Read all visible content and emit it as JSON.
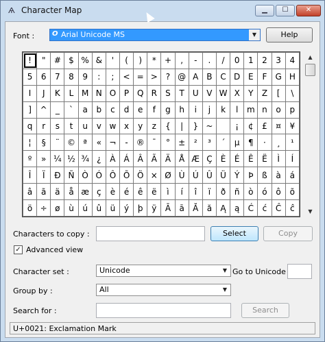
{
  "window": {
    "title": "Character Map",
    "app_icon": "character-map-icon",
    "controls": {
      "minimize": "▁",
      "maximize": "☐",
      "close": "✕"
    }
  },
  "font_row": {
    "label": "Font :",
    "selected": "Arial Unicode MS",
    "font_icon": "O",
    "help_label": "Help"
  },
  "grid": {
    "rows": [
      [
        "!",
        "\"",
        "#",
        "$",
        "%",
        "&",
        "'",
        "(",
        ")",
        "*",
        "+",
        ",",
        "-",
        ".",
        "/",
        "0",
        "1",
        "2",
        "3",
        "4"
      ],
      [
        "5",
        "6",
        "7",
        "8",
        "9",
        ":",
        ";",
        "<",
        "=",
        ">",
        "?",
        "@",
        "A",
        "B",
        "C",
        "D",
        "E",
        "F",
        "G",
        "H"
      ],
      [
        "I",
        "J",
        "K",
        "L",
        "M",
        "N",
        "O",
        "P",
        "Q",
        "R",
        "S",
        "T",
        "U",
        "V",
        "W",
        "X",
        "Y",
        "Z",
        "[",
        "\\"
      ],
      [
        "]",
        "^",
        "_",
        "`",
        "a",
        "b",
        "c",
        "d",
        "e",
        "f",
        "g",
        "h",
        "i",
        "j",
        "k",
        "l",
        "m",
        "n",
        "o",
        "p"
      ],
      [
        "q",
        "r",
        "s",
        "t",
        "u",
        "v",
        "w",
        "x",
        "y",
        "z",
        "{",
        "|",
        "}",
        "~",
        " ",
        "¡",
        "¢",
        "£",
        "¤",
        "¥"
      ],
      [
        "¦",
        "§",
        "¨",
        "©",
        "ª",
        "«",
        "¬",
        "-",
        "®",
        "¯",
        "°",
        "±",
        "²",
        "³",
        "´",
        "µ",
        "¶",
        "·",
        "¸",
        "¹"
      ],
      [
        "º",
        "»",
        "¼",
        "½",
        "¾",
        "¿",
        "À",
        "Á",
        "Â",
        "Ã",
        "Ä",
        "Å",
        "Æ",
        "Ç",
        "È",
        "É",
        "Ê",
        "Ë",
        "Ì",
        "Í"
      ],
      [
        "Î",
        "Ï",
        "Ð",
        "Ñ",
        "Ò",
        "Ó",
        "Ô",
        "Õ",
        "Ö",
        "×",
        "Ø",
        "Ù",
        "Ú",
        "Û",
        "Ü",
        "Ý",
        "Þ",
        "ß",
        "à",
        "á"
      ],
      [
        "â",
        "ã",
        "ä",
        "å",
        "æ",
        "ç",
        "è",
        "é",
        "ê",
        "ë",
        "ì",
        "í",
        "î",
        "ï",
        "ð",
        "ñ",
        "ò",
        "ó",
        "ô",
        "õ"
      ],
      [
        "ö",
        "÷",
        "ø",
        "ù",
        "ú",
        "û",
        "ü",
        "ý",
        "þ",
        "ÿ",
        "Ā",
        "ā",
        "Ă",
        "ă",
        "Ą",
        "ą",
        "Ć",
        "ć",
        "Ĉ",
        "ĉ"
      ]
    ],
    "selected": "!"
  },
  "copy_row": {
    "label": "Characters to copy :",
    "value": "",
    "select_label": "Select",
    "copy_label": "Copy"
  },
  "advanced": {
    "label": "Advanced view",
    "checked": "✓"
  },
  "charset_row": {
    "label": "Character set :",
    "selected": "Unicode",
    "goto_label": "Go to Unicode :",
    "goto_value": ""
  },
  "groupby_row": {
    "label": "Group by :",
    "selected": "All"
  },
  "search_row": {
    "label": "Search for :",
    "value": "",
    "search_label": "Search"
  },
  "status": {
    "text": "U+0021: Exclamation Mark"
  },
  "scrollbar": {
    "up": "▲",
    "down": "▼"
  },
  "colors": {
    "accent": "#3399ff",
    "frame": "#c9dcef",
    "close": "#c2412a"
  }
}
